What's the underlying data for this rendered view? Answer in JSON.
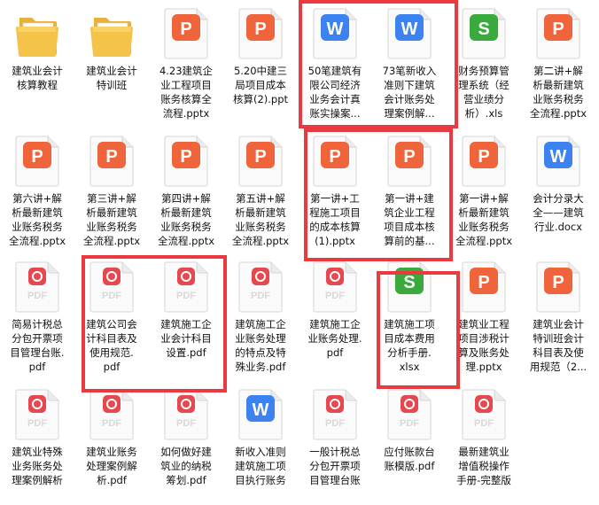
{
  "files": [
    {
      "type": "folder",
      "lines": [
        "建筑业会计",
        "核算教程"
      ]
    },
    {
      "type": "folder",
      "lines": [
        "建筑业会计",
        "特训班"
      ]
    },
    {
      "type": "pptx",
      "lines": [
        "4.23建筑企",
        "业工程项目",
        "账务核算全",
        "流程.pptx"
      ]
    },
    {
      "type": "pptx",
      "lines": [
        "5.20中建三",
        "局项目成本",
        "核算(2).ppt"
      ]
    },
    {
      "type": "docx",
      "lines": [
        "50笔建筑有",
        "限公司经济",
        "业务会计真",
        "账实操案..."
      ]
    },
    {
      "type": "docx",
      "lines": [
        "73笔新收入",
        "准则下建筑",
        "会计账务处",
        "理案例解..."
      ]
    },
    {
      "type": "xls",
      "lines": [
        "财务预算管",
        "理系统（经",
        "营业绩分",
        "析）.xls"
      ]
    },
    {
      "type": "pptx",
      "lines": [
        "第二讲+解",
        "析最新建筑",
        "业账务税务",
        "全流程.pptx"
      ]
    },
    {
      "type": "pptx",
      "lines": [
        "第六讲+解",
        "析最新建筑",
        "业账务税务",
        "全流程.pptx"
      ]
    },
    {
      "type": "pptx",
      "lines": [
        "第三讲+解",
        "析最新建筑",
        "业账务税务",
        "全流程.pptx"
      ]
    },
    {
      "type": "pptx",
      "lines": [
        "第四讲+解",
        "析最新建筑",
        "业账务税务",
        "全流程.pptx"
      ]
    },
    {
      "type": "pptx",
      "lines": [
        "第五讲+解",
        "析最新建筑",
        "业账务税务",
        "全流程.pptx"
      ]
    },
    {
      "type": "pptx",
      "lines": [
        "第一讲+工",
        "程施工项目",
        "的成本核算",
        "(1).pptx"
      ]
    },
    {
      "type": "pptx",
      "lines": [
        "第一讲+建",
        "筑企业工程",
        "项目成本核",
        "算前的基..."
      ]
    },
    {
      "type": "pptx",
      "lines": [
        "第一讲+解",
        "析最新建筑",
        "业账务税务",
        "全流程.pptx"
      ]
    },
    {
      "type": "docx",
      "lines": [
        "会计分录大",
        "全——建筑",
        "行业.docx"
      ]
    },
    {
      "type": "pdf",
      "lines": [
        "简易计税总",
        "分包开票项",
        "目管理台账.",
        "pdf"
      ]
    },
    {
      "type": "pdf",
      "lines": [
        "建筑公司会",
        "计科目表及",
        "使用规范.",
        "pdf"
      ]
    },
    {
      "type": "pdf",
      "lines": [
        "建筑施工企",
        "业会计科目",
        "设置.pdf"
      ]
    },
    {
      "type": "pdf",
      "lines": [
        "建筑施工企",
        "业账务处理",
        "的特点及特",
        "殊业务.pdf"
      ]
    },
    {
      "type": "pdf",
      "lines": [
        "建筑施工企",
        "业账务处理.",
        "pdf"
      ]
    },
    {
      "type": "xlsx",
      "lines": [
        "建筑施工项",
        "目成本费用",
        "分析手册.",
        "xlsx"
      ]
    },
    {
      "type": "pptx",
      "lines": [
        "建筑业工程",
        "项目涉税计",
        "算及账务处",
        "理.pptx"
      ]
    },
    {
      "type": "pptx",
      "lines": [
        "建筑业会计",
        "特训班会计",
        "科目表及使",
        "用规范（2..."
      ]
    },
    {
      "type": "pdf",
      "lines": [
        "建筑业特殊",
        "业务账务处",
        "理案例解析"
      ]
    },
    {
      "type": "pdf",
      "lines": [
        "建筑业账务",
        "处理案例解",
        "析.pdf"
      ]
    },
    {
      "type": "pdf",
      "lines": [
        "如何做好建",
        "筑业的纳税",
        "筹划.pdf"
      ]
    },
    {
      "type": "docx",
      "lines": [
        "新收入准则",
        "建筑施工项",
        "目执行账务"
      ]
    },
    {
      "type": "pdf",
      "lines": [
        "一般计税总",
        "分包开票项",
        "目管理台账"
      ]
    },
    {
      "type": "pdf",
      "lines": [
        "应付账款台",
        "账模版.pdf"
      ]
    },
    {
      "type": "pdf",
      "lines": [
        "最新建筑业",
        "增值税操作",
        "手册-完整版"
      ]
    },
    {
      "type": "none",
      "lines": []
    }
  ],
  "icons": {
    "folder": {
      "glyph": "",
      "color": "#f5c24a"
    },
    "pptx": {
      "glyph": "P",
      "color": "#f0643c"
    },
    "docx": {
      "glyph": "W",
      "color": "#3c82f0"
    },
    "xls": {
      "glyph": "S",
      "color": "#3aaa3c"
    },
    "xlsx": {
      "glyph": "S",
      "color": "#3aaa3c"
    },
    "pdf": {
      "glyph": "",
      "color": "#e64850",
      "sub": "PDF"
    }
  }
}
